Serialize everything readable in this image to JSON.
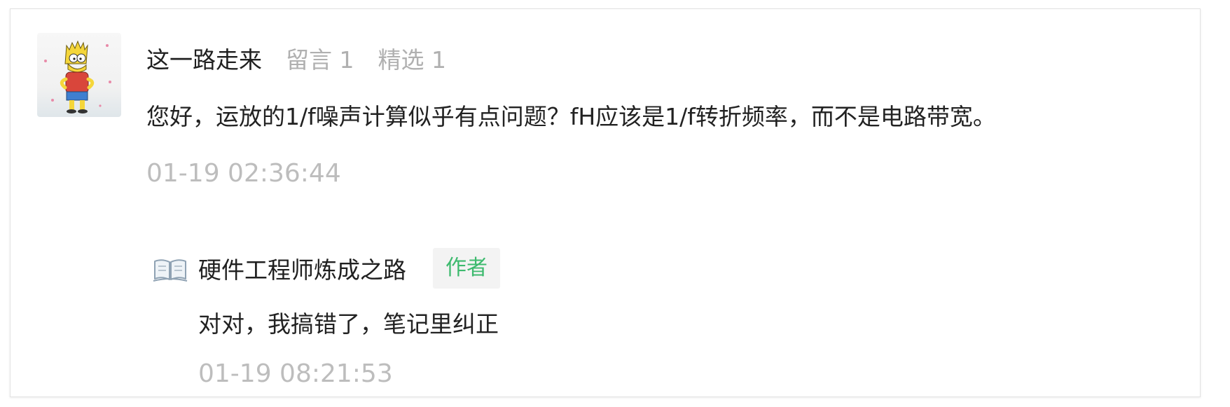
{
  "comment": {
    "nickname": "这一路走来",
    "message_count": "留言 1",
    "featured_count": "精选 1",
    "text": "您好，运放的1/f噪声计算似乎有点问题？fH应该是1/f转折频率，而不是电路带宽。",
    "time": "01-19 02:36:44",
    "avatar_icon": "cartoon-avatar"
  },
  "reply": {
    "author_name": "硬件工程师炼成之路",
    "badge": "作者",
    "text": "对对，我搞错了，笔记里纠正",
    "time": "01-19 08:21:53",
    "icon": "open-book-icon"
  },
  "colors": {
    "badge_text": "#3dba6e",
    "badge_bg": "#f3f3f3",
    "muted_text": "#b0b0b0"
  }
}
